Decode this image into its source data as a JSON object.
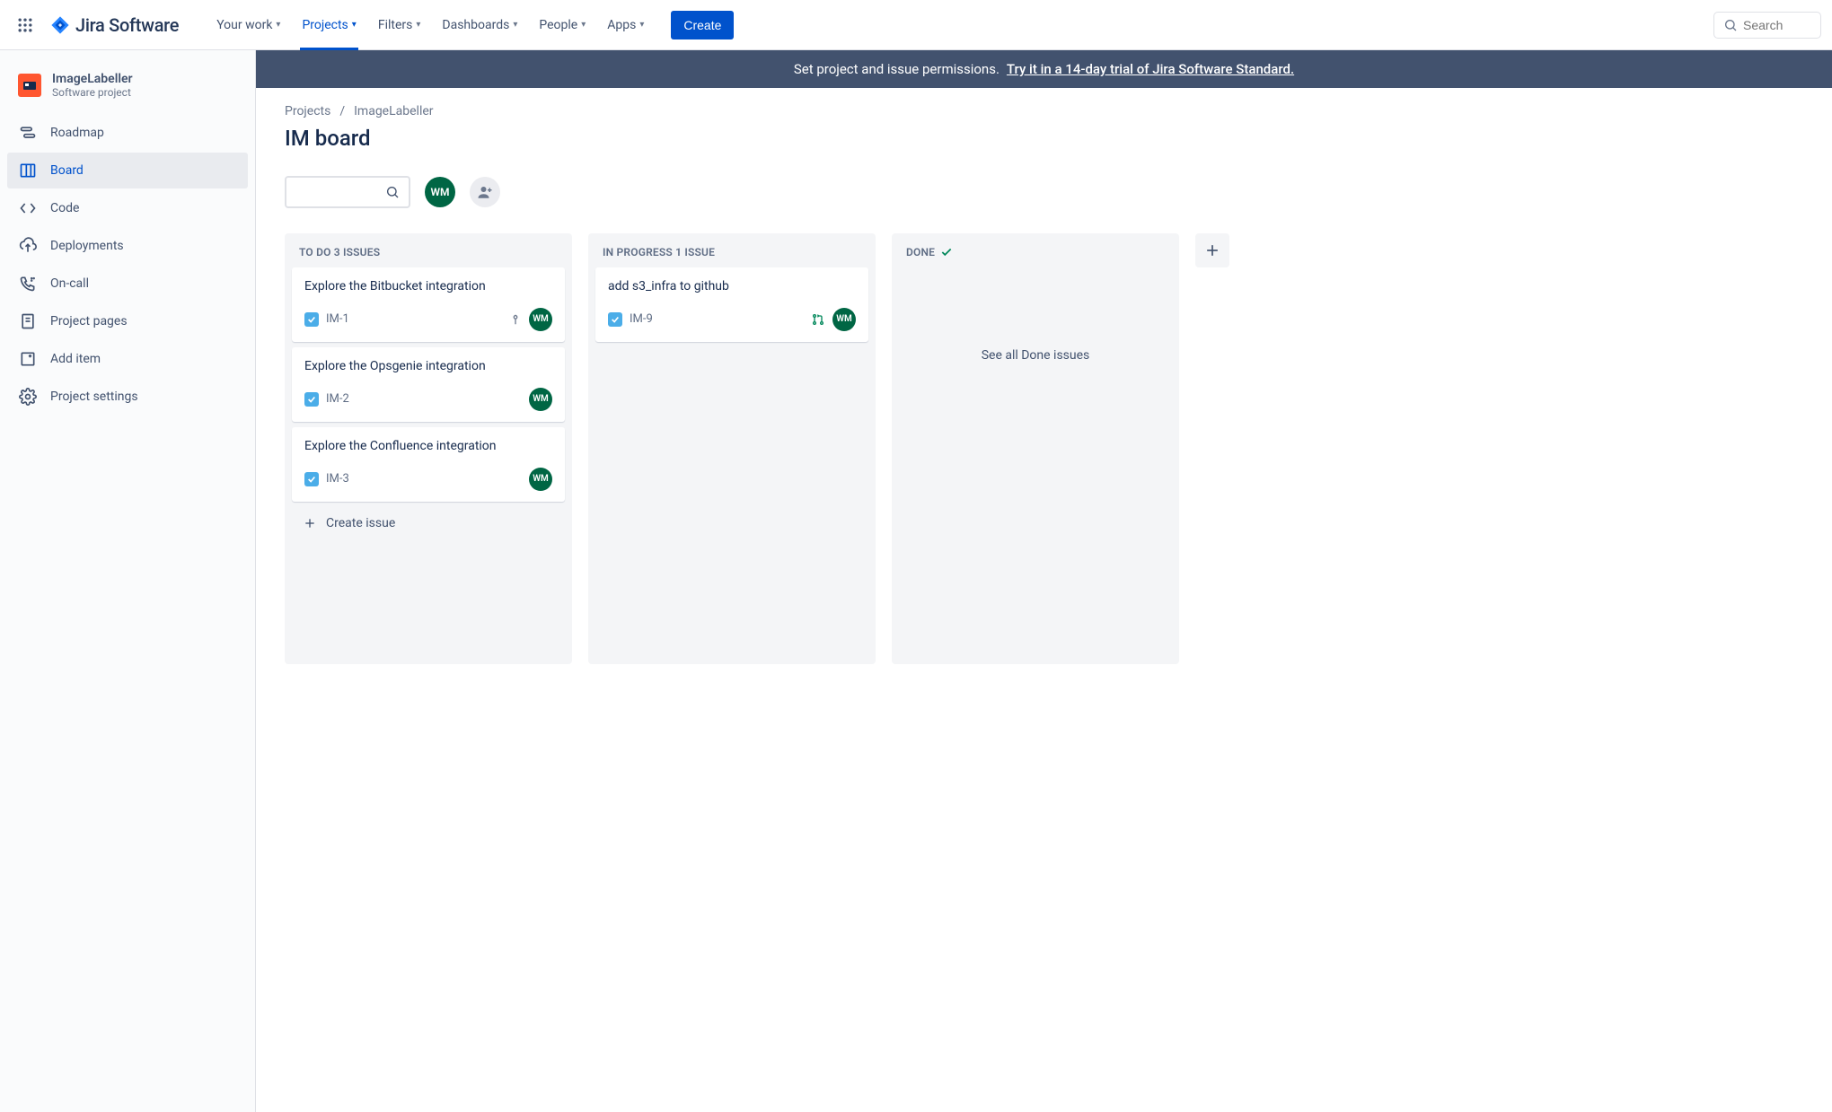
{
  "topnav": {
    "logo_text": "Jira Software",
    "items": [
      {
        "label": "Your work"
      },
      {
        "label": "Projects",
        "active": true
      },
      {
        "label": "Filters"
      },
      {
        "label": "Dashboards"
      },
      {
        "label": "People"
      },
      {
        "label": "Apps"
      }
    ],
    "create_label": "Create",
    "search_placeholder": "Search"
  },
  "sidebar": {
    "project_name": "ImageLabeller",
    "project_type": "Software project",
    "items": [
      {
        "label": "Roadmap",
        "icon": "roadmap"
      },
      {
        "label": "Board",
        "icon": "board",
        "active": true
      },
      {
        "label": "Code",
        "icon": "code"
      },
      {
        "label": "Deployments",
        "icon": "cloud-up"
      },
      {
        "label": "On-call",
        "icon": "phone"
      },
      {
        "label": "Project pages",
        "icon": "page"
      },
      {
        "label": "Add item",
        "icon": "add-item"
      },
      {
        "label": "Project settings",
        "icon": "gear"
      }
    ]
  },
  "banner": {
    "text": "Set project and issue permissions.",
    "link_text": "Try it in a 14-day trial of Jira Software Standard."
  },
  "breadcrumb": {
    "root": "Projects",
    "current": "ImageLabeller"
  },
  "page_title": "IM board",
  "toolbar": {
    "avatar_initials": "WM"
  },
  "columns": [
    {
      "id": "todo",
      "header": "TO DO 3 ISSUES",
      "cards": [
        {
          "title": "Explore the Bitbucket integration",
          "key": "IM-1",
          "assignee": "WM",
          "priority": true
        },
        {
          "title": "Explore the Opsgenie integration",
          "key": "IM-2",
          "assignee": "WM"
        },
        {
          "title": "Explore the Confluence integration",
          "key": "IM-3",
          "assignee": "WM"
        }
      ],
      "create_label": "Create issue"
    },
    {
      "id": "inprogress",
      "header": "IN PROGRESS 1 ISSUE",
      "cards": [
        {
          "title": "add s3_infra to github",
          "key": "IM-9",
          "assignee": "WM",
          "pr": true
        }
      ]
    },
    {
      "id": "done",
      "header": "DONE",
      "done_check": true,
      "see_all": "See all Done issues"
    }
  ]
}
